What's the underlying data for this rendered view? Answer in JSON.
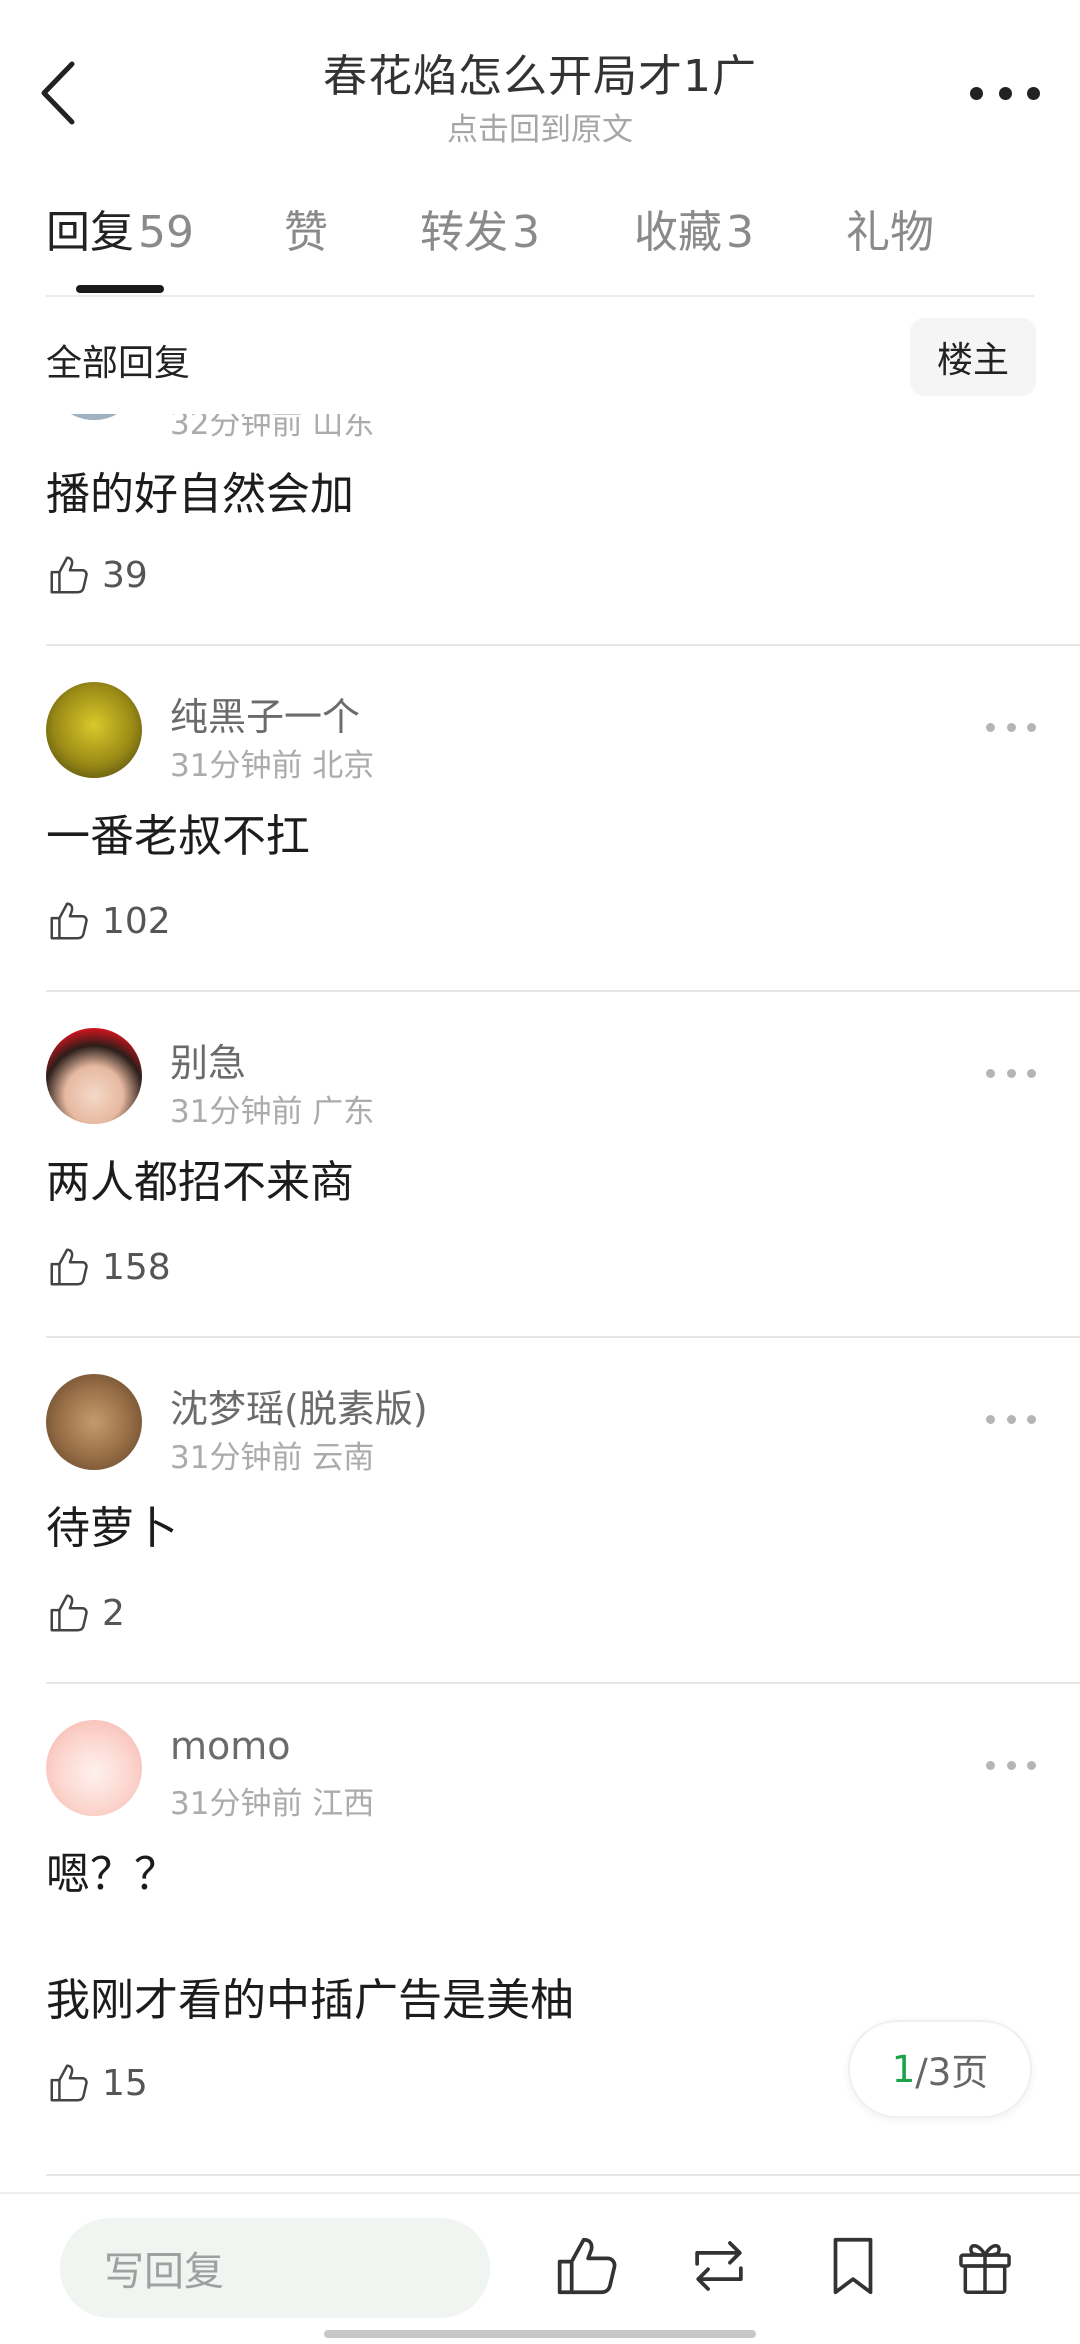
{
  "header": {
    "title": "春花焰怎么开局才1广",
    "subtitle": "点击回到原文"
  },
  "tabs": [
    {
      "label": "回复",
      "count": "59"
    },
    {
      "label": "赞",
      "count": ""
    },
    {
      "label": "转发",
      "count": "3"
    },
    {
      "label": "收藏",
      "count": "3"
    },
    {
      "label": "礼物",
      "count": ""
    }
  ],
  "filter": {
    "label": "全部回复",
    "op_button": "楼主"
  },
  "comments": [
    {
      "name": "",
      "meta": "32分钟前 山东",
      "text": "播的好自然会加",
      "likes": "39"
    },
    {
      "name": "纯黑子一个",
      "meta": "31分钟前 北京",
      "text": "一番老叔不扛",
      "likes": "102"
    },
    {
      "name": "别急",
      "meta": "31分钟前 广东",
      "text": "两人都招不来商",
      "likes": "158"
    },
    {
      "name": "沈梦瑶(脱素版)",
      "meta": "31分钟前 云南",
      "text": "待萝卜",
      "likes": "2"
    },
    {
      "name": "momo",
      "meta": "31分钟前 江西",
      "text": "嗯？？",
      "text2": "我刚才看的中插广告是美柚",
      "likes": "15"
    }
  ],
  "pager": {
    "current": "1",
    "total_text": "/3页"
  },
  "bottom_bar": {
    "reply_placeholder": "写回复"
  },
  "colors": {
    "accent_green": "#1aa34a",
    "input_bg": "#f0f5f1"
  }
}
